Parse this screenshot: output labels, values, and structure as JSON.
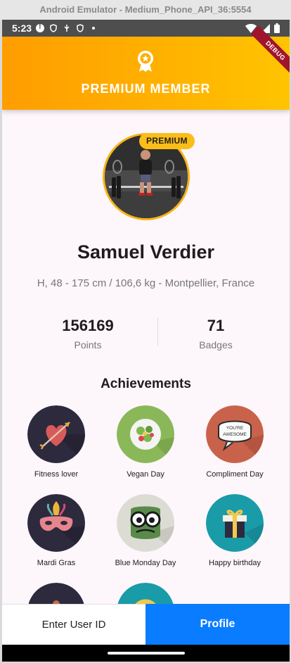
{
  "window": {
    "title": "Android Emulator - Medium_Phone_API_36:5554"
  },
  "status_bar": {
    "time": "5:23"
  },
  "header": {
    "title": "PREMIUM MEMBER",
    "debug_label": "DEBUG",
    "gradient_start": "#ff9d00",
    "gradient_end": "#ffc400"
  },
  "profile": {
    "premium_badge": "PREMIUM",
    "name": "Samuel Verdier",
    "info": "H, 48 - 175 cm / 106,6 kg - Montpellier, France"
  },
  "stats": {
    "points": {
      "value": "156169",
      "label": "Points"
    },
    "badges": {
      "value": "71",
      "label": "Badges"
    }
  },
  "achievements": {
    "title": "Achievements",
    "items": [
      {
        "label": "Fitness lover",
        "icon": "heart-arrow-icon",
        "color": "#2d2a3e"
      },
      {
        "label": "Vegan Day",
        "icon": "salad-bowl-icon",
        "color": "#8ab859"
      },
      {
        "label": "Compliment Day",
        "icon": "speech-bubble-icon",
        "color": "#c9624b",
        "bubble_text": "YOU'RE AWESOME"
      },
      {
        "label": "Mardi Gras",
        "icon": "carnival-mask-icon",
        "color": "#2d2a3e"
      },
      {
        "label": "Blue Monday Day",
        "icon": "monster-eyes-icon",
        "color": "#dcdcd5"
      },
      {
        "label": "Happy birthday",
        "icon": "gift-box-icon",
        "color": "#1a9ba8"
      }
    ]
  },
  "bottom": {
    "enter_user_label": "Enter User ID",
    "profile_label": "Profile",
    "profile_color": "#0a7cff"
  }
}
